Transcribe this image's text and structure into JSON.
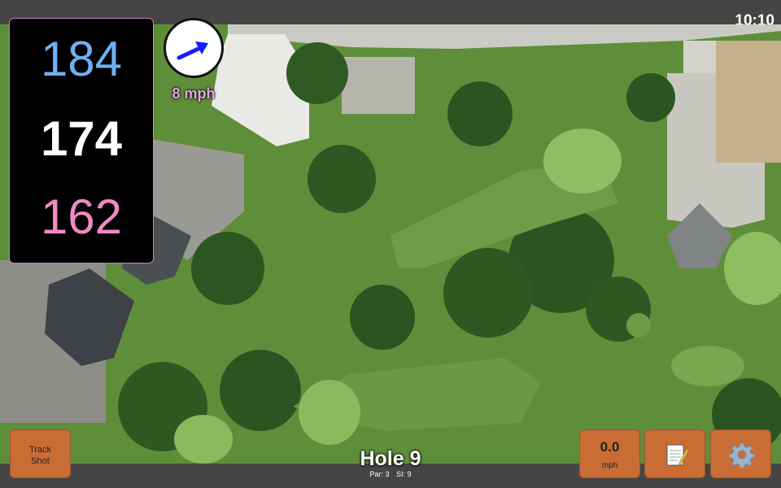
{
  "status": {
    "clock": "10:10"
  },
  "distances": {
    "back": "184",
    "middle": "174",
    "front": "162"
  },
  "wind": {
    "speed_label": "8 mph"
  },
  "hole": {
    "title": "Hole 9",
    "par_label": "Par: 3",
    "si_label": "SI: 9"
  },
  "buttons": {
    "track_shot_line1": "Track",
    "track_shot_line2": "Shot",
    "speed_value": "0.0",
    "speed_unit": "mph",
    "notes_icon": "notepad-icon",
    "settings_icon": "gear-icon"
  },
  "colors": {
    "back_distance": "#6fb0f0",
    "middle_distance": "#ffffff",
    "front_distance": "#f08ac4",
    "wind_label": "#e2a4e0",
    "button": "#c96d35"
  }
}
